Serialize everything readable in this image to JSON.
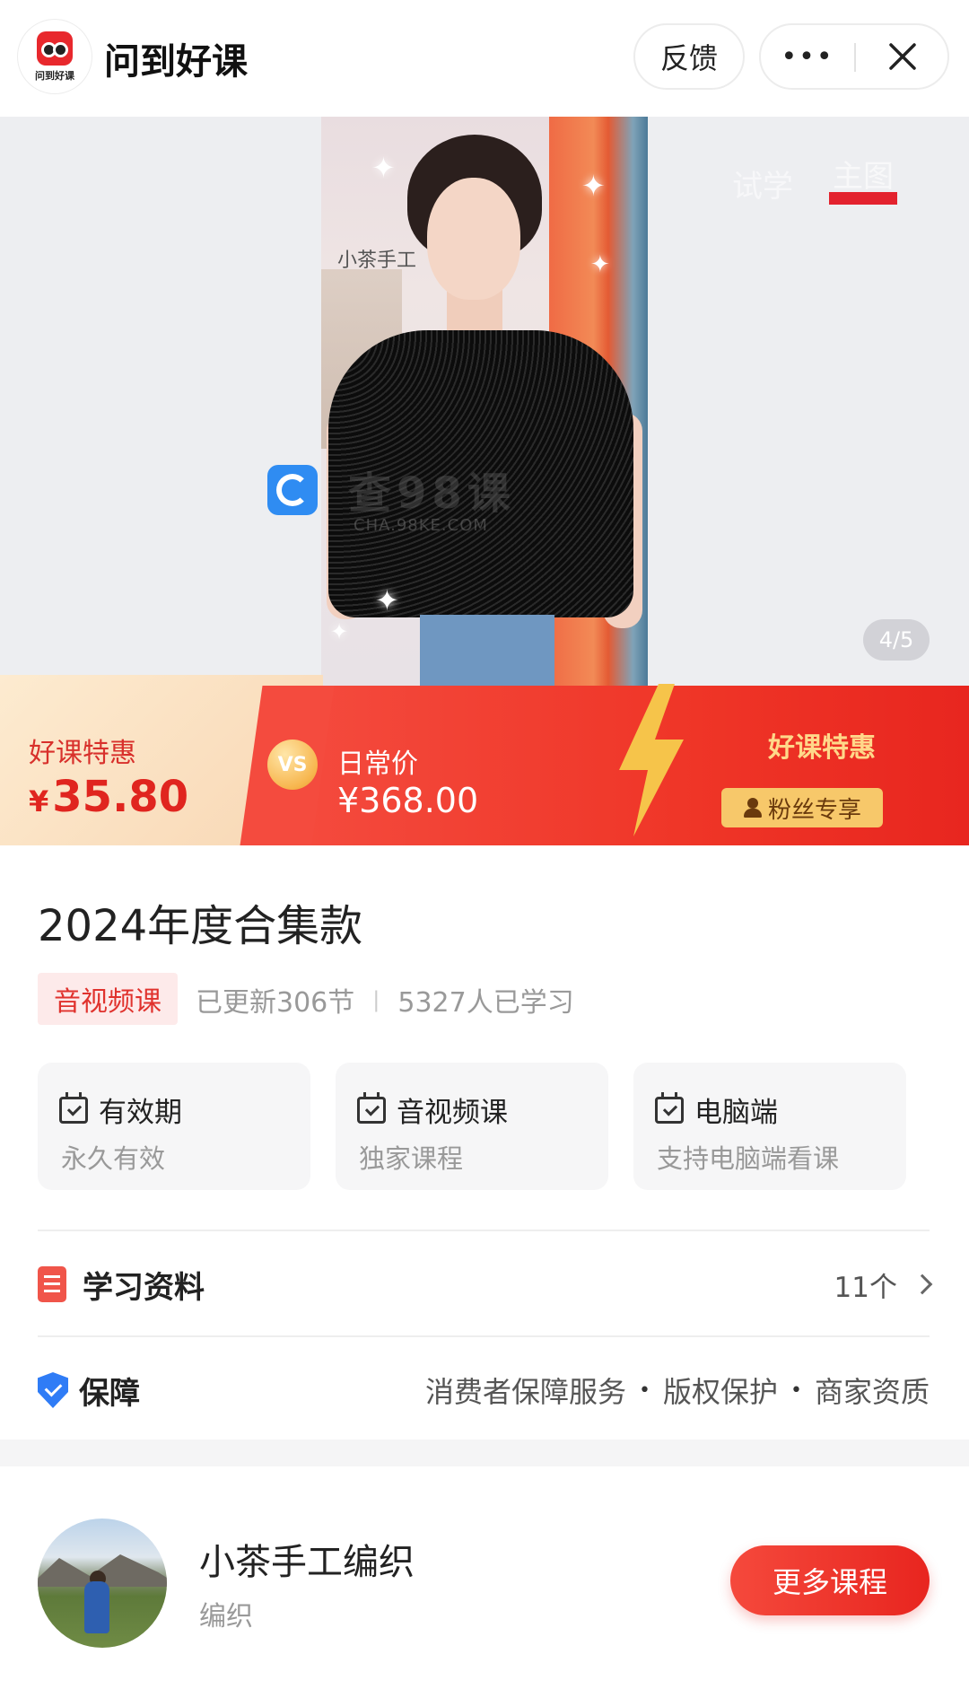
{
  "app": {
    "logo_text": "问到好课",
    "title": "问到好课",
    "feedback_label": "反馈",
    "more_label": "•••",
    "close_icon": "close-icon"
  },
  "hero": {
    "watermark_top": "小茶手工",
    "watermark_mid": "查98课",
    "watermark_url": "CHA.98KE.COM",
    "tabs": [
      {
        "label": "试学",
        "active": false
      },
      {
        "label": "主图",
        "active": true
      }
    ],
    "counter": "4/5"
  },
  "price": {
    "deal_label": "好课特惠",
    "deal_currency": "¥",
    "deal_value": "35.80",
    "vs": "VS",
    "regular_label": "日常价",
    "regular_price": "¥368.00",
    "promo_label": "好课特惠",
    "fans_badge": "粉丝专享",
    "colors": {
      "deal": "#e0251f",
      "banner": "#ef3527",
      "gold": "#f7c86a"
    }
  },
  "course": {
    "title": "2024年度合集款",
    "type_tag": "音视频课",
    "updated": "已更新306节",
    "learners": "5327人已学习",
    "features": [
      {
        "title": "有效期",
        "subtitle": "永久有效",
        "icon": "calendar-check-icon"
      },
      {
        "title": "音视频课",
        "subtitle": "独家课程",
        "icon": "calendar-check-icon"
      },
      {
        "title": "电脑端",
        "subtitle": "支持电脑端看课",
        "icon": "calendar-check-icon"
      }
    ]
  },
  "materials": {
    "label": "学习资料",
    "count": "11个",
    "icon": "document-icon"
  },
  "guarantee": {
    "label": "保障",
    "items": [
      "消费者保障服务",
      "版权保护",
      "商家资质"
    ],
    "separator": "•",
    "icon": "shield-icon"
  },
  "author": {
    "name": "小茶手工编织",
    "tag": "编织",
    "more_courses": "更多课程"
  }
}
